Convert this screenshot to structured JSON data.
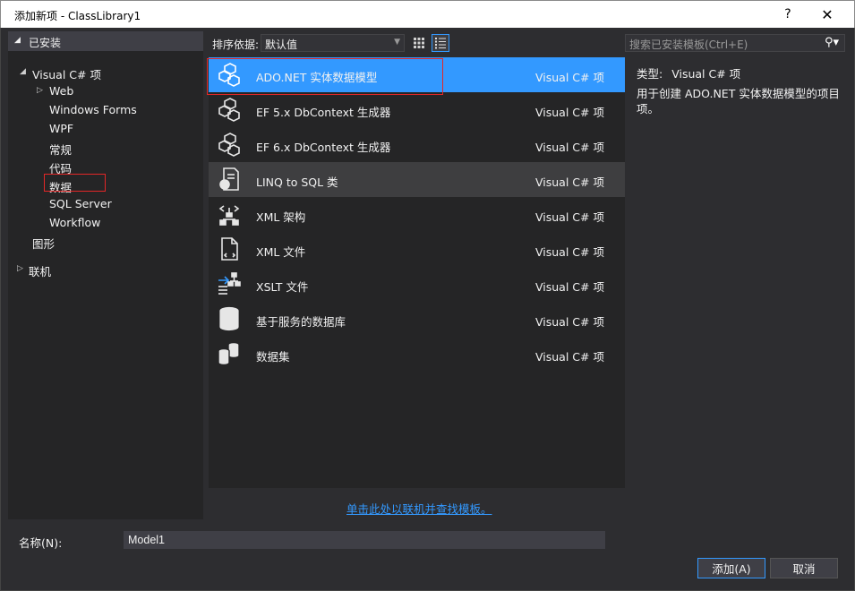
{
  "window": {
    "title": "添加新项 - ClassLibrary1",
    "help": "?",
    "close": "✕"
  },
  "tree": {
    "header": "已安装",
    "items": [
      {
        "label": "Visual C# 项"
      },
      {
        "label": "Web"
      },
      {
        "label": "Windows Forms"
      },
      {
        "label": "WPF"
      },
      {
        "label": "常规"
      },
      {
        "label": "代码"
      },
      {
        "label": "数据"
      },
      {
        "label": "SQL Server"
      },
      {
        "label": "Workflow"
      },
      {
        "label": "图形"
      },
      {
        "label": "联机"
      }
    ]
  },
  "toolbar": {
    "sort_label": "排序依据:",
    "sort_value": "默认值",
    "search_placeholder": "搜索已安装模板(Ctrl+E)"
  },
  "templates": [
    {
      "name": "ADO.NET 实体数据模型",
      "lang": "Visual C# 项",
      "icon": "ado-entity-icon"
    },
    {
      "name": "EF 5.x DbContext 生成器",
      "lang": "Visual C# 项",
      "icon": "ef5-generator-icon"
    },
    {
      "name": "EF 6.x DbContext 生成器",
      "lang": "Visual C# 项",
      "icon": "ef6-generator-icon"
    },
    {
      "name": "LINQ to SQL 类",
      "lang": "Visual C# 项",
      "icon": "linq-sql-icon"
    },
    {
      "name": "XML 架构",
      "lang": "Visual C# 项",
      "icon": "xml-schema-icon"
    },
    {
      "name": "XML 文件",
      "lang": "Visual C# 项",
      "icon": "xml-file-icon"
    },
    {
      "name": "XSLT 文件",
      "lang": "Visual C# 项",
      "icon": "xslt-file-icon"
    },
    {
      "name": "基于服务的数据库",
      "lang": "Visual C# 项",
      "icon": "database-icon"
    },
    {
      "name": "数据集",
      "lang": "Visual C# 项",
      "icon": "dataset-icon"
    }
  ],
  "online_link": "单击此处以联机并查找模板。",
  "info": {
    "type_label": "类型:",
    "type_value": "Visual C# 项",
    "description": "用于创建 ADO.NET 实体数据模型的项目项。"
  },
  "footer": {
    "name_label": "名称(N):",
    "name_value": "Model1",
    "add_label": "添加(A)",
    "cancel_label": "取消"
  },
  "colors": {
    "accent": "#3399ff",
    "highlight_border": "#e32727",
    "background": "#2d2d30"
  }
}
